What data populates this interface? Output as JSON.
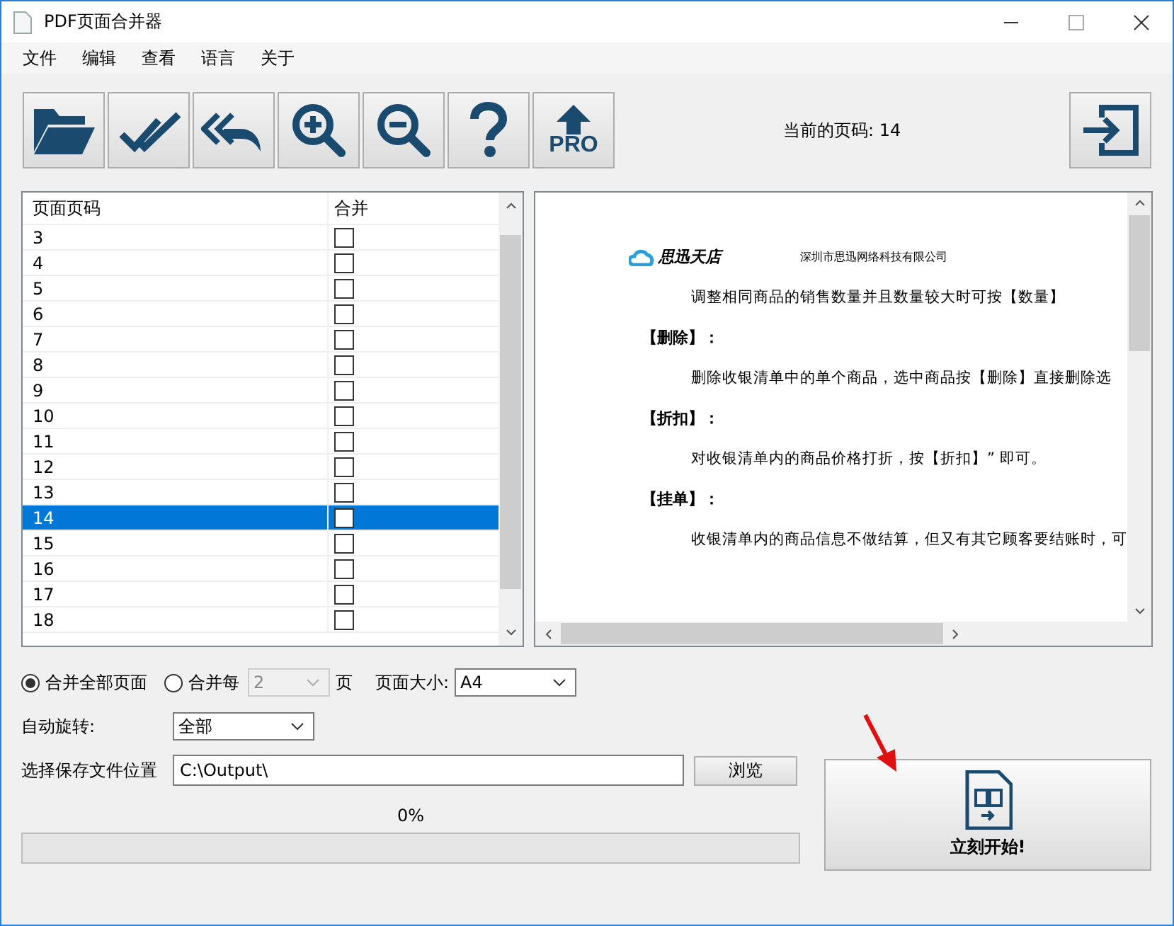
{
  "window": {
    "title": "PDF页面合并器"
  },
  "menu": [
    "文件",
    "编辑",
    "查看",
    "语言",
    "关于"
  ],
  "toolbar": [
    {
      "kind": "open"
    },
    {
      "kind": "check"
    },
    {
      "kind": "undo"
    },
    {
      "kind": "zoom-in"
    },
    {
      "kind": "zoom-out"
    },
    {
      "kind": "help"
    },
    {
      "kind": "pro",
      "label": "PRO"
    }
  ],
  "current_page": "当前的页码: 14",
  "table": {
    "columns": [
      "页面页码",
      "合并"
    ],
    "rows": [
      {
        "page": "3",
        "checked": false,
        "selected": false
      },
      {
        "page": "4",
        "checked": false,
        "selected": false
      },
      {
        "page": "5",
        "checked": false,
        "selected": false
      },
      {
        "page": "6",
        "checked": false,
        "selected": false
      },
      {
        "page": "7",
        "checked": false,
        "selected": false
      },
      {
        "page": "8",
        "checked": false,
        "selected": false
      },
      {
        "page": "9",
        "checked": false,
        "selected": false
      },
      {
        "page": "10",
        "checked": false,
        "selected": false
      },
      {
        "page": "11",
        "checked": false,
        "selected": false
      },
      {
        "page": "12",
        "checked": false,
        "selected": false
      },
      {
        "page": "13",
        "checked": false,
        "selected": false
      },
      {
        "page": "14",
        "checked": false,
        "selected": true
      },
      {
        "page": "15",
        "checked": false,
        "selected": false
      },
      {
        "page": "16",
        "checked": false,
        "selected": false
      },
      {
        "page": "17",
        "checked": false,
        "selected": false
      },
      {
        "page": "18",
        "checked": false,
        "selected": false
      }
    ]
  },
  "preview": {
    "brand": "思迅天店",
    "company": "深圳市思迅网络科技有限公司",
    "lines": [
      {
        "kind": "body",
        "text": "调整相同商品的销售数量并且数量较大时可按【数量】"
      },
      {
        "kind": "heading",
        "text": "【删除】："
      },
      {
        "kind": "body",
        "text": "删除收银清单中的单个商品，选中商品按【删除】直接删除选"
      },
      {
        "kind": "heading",
        "text": "【折扣】："
      },
      {
        "kind": "body",
        "text": "对收银清单内的商品价格打折，按【折扣】” 即可。"
      },
      {
        "kind": "heading",
        "text": "【挂单】："
      },
      {
        "kind": "body",
        "text": "收银清单内的商品信息不做结算，但又有其它顾客要结账时，可"
      }
    ]
  },
  "merge_options": [
    {
      "label": "合并全部页面",
      "selected": true
    },
    {
      "label": "合并每",
      "selected": false
    }
  ],
  "every_value": "2",
  "every_unit": "页",
  "page_size": {
    "label": "页面大小:",
    "value": "A4"
  },
  "rotate": {
    "label": "自动旋转:",
    "value": "全部"
  },
  "save": {
    "label": "选择保存文件位置",
    "value": "C:\\Output\\",
    "browse": "浏览"
  },
  "progress": {
    "text": "0%",
    "level": 0
  },
  "start_button": "立刻开始!"
}
